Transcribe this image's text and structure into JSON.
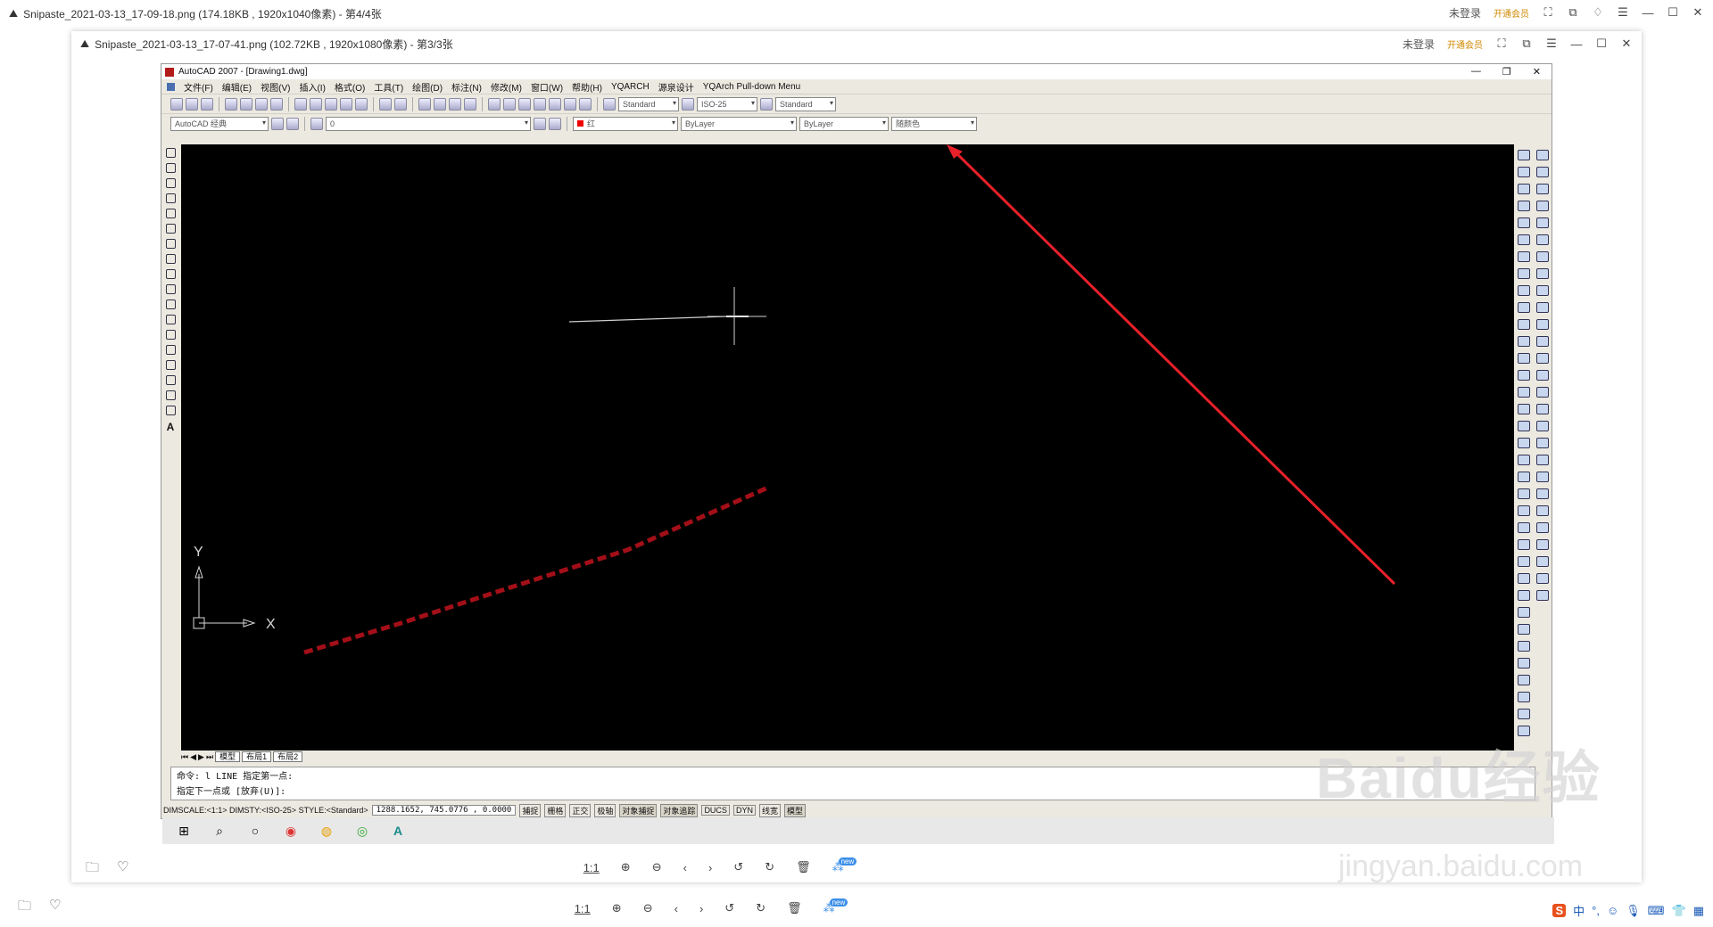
{
  "outer": {
    "title": "Snipaste_2021-03-13_17-09-18.png (174.18KB , 1920x1040像素) - 第4/4张",
    "login": "未登录",
    "vip": "开通会员"
  },
  "inner": {
    "title": "Snipaste_2021-03-13_17-07-41.png (102.72KB , 1920x1080像素) - 第3/3张",
    "login": "未登录",
    "vip": "开通会员"
  },
  "acad": {
    "title": "AutoCAD 2007 - [Drawing1.dwg]",
    "menu": [
      "文件(F)",
      "编辑(E)",
      "视图(V)",
      "插入(I)",
      "格式(O)",
      "工具(T)",
      "绘图(D)",
      "标注(N)",
      "修改(M)",
      "窗口(W)",
      "帮助(H)",
      "YQARCH",
      "源泉设计",
      "YQArch Pull-down Menu"
    ],
    "combos": {
      "text_style": "Standard",
      "dim_style": "ISO-25",
      "table_style": "Standard",
      "workspace": "AutoCAD 经典",
      "layer": "0",
      "color": "红",
      "linetype": "ByLayer",
      "lineweight": "ByLayer",
      "plotstyle": "随颜色"
    },
    "tabs": [
      "模型",
      "布局1",
      "布局2"
    ],
    "command_lines": [
      "命令: l LINE 指定第一点:",
      "指定下一点或 [放弃(U)]:"
    ],
    "status_left": "DIMSCALE:<1:1> DIMSTY:<ISO-25> STYLE:<Standard>",
    "coords": "1288.1652, 745.0776 , 0.0000",
    "status_buttons": [
      "捕捉",
      "栅格",
      "正交",
      "极轴",
      "对象捕捉",
      "对象追踪",
      "DUCS",
      "DYN",
      "线宽",
      "模型"
    ],
    "axis_y": "Y",
    "axis_x": "X"
  },
  "bottom": {
    "zoom_label": "1:1",
    "new_badge": "new"
  },
  "watermark": {
    "main": "Baidu经验",
    "sub": "jingyan.baidu.com"
  },
  "ime": {
    "lang": "中",
    "mark": "°,"
  },
  "colors": {
    "arrow": "#e8202a",
    "canvas": "#000000",
    "accent": "#3b8fe8"
  }
}
